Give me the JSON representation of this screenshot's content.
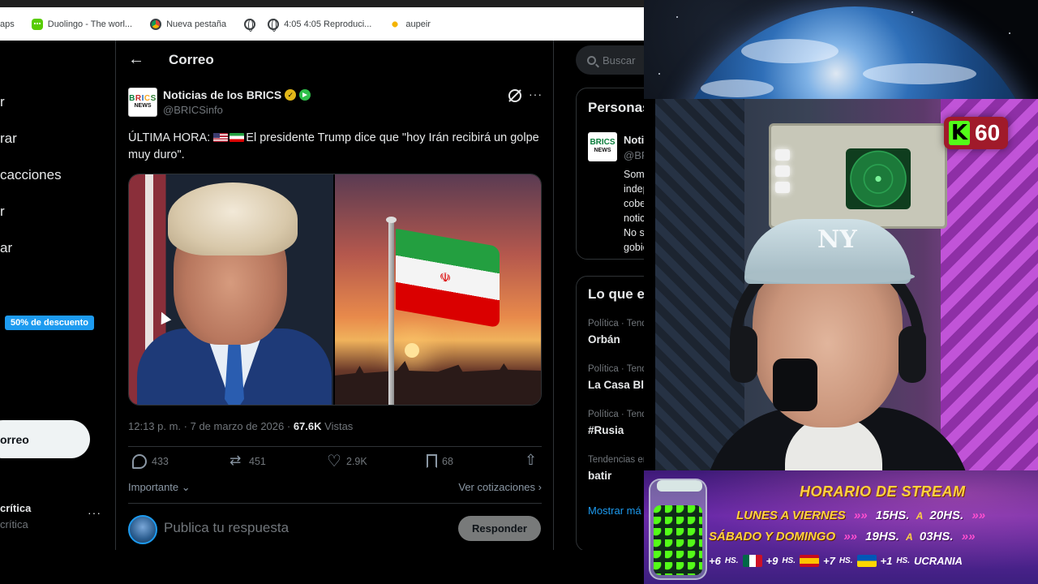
{
  "bookmarks": [
    {
      "label": "aps",
      "icon": "none"
    },
    {
      "label": "Duolingo - The worl...",
      "icon": "duolingo-icon"
    },
    {
      "label": "Nueva pestaña",
      "icon": "chrome-icon"
    },
    {
      "label": "",
      "icon": "globe-icon"
    },
    {
      "label": "4:05 4:05 Reproduci...",
      "icon": "globe-icon"
    },
    {
      "label": "aupeir",
      "icon": "aupeir-icon"
    }
  ],
  "leftnav": {
    "items": [
      "r",
      "rar",
      "cacciones",
      "r",
      "ar"
    ],
    "discount": "50% de descuento",
    "post_button": "orreo",
    "account_name": "crítica",
    "account_handle": "crítica",
    "more": "···"
  },
  "header": {
    "back_icon": "←",
    "title": "Correo"
  },
  "tweet": {
    "author_name": "Noticias de los BRICS",
    "author_handle": "@BRICSinfo",
    "avatar_top": "BRICS",
    "avatar_bottom": "NEWS",
    "more": "···",
    "text_prefix": "ÚLTIMA HORA: ",
    "text_body": "El presidente Trump dice que \"hoy Irán recibirá un golpe muy duro\".",
    "time": "12:13 p. m.",
    "date": "7 de marzo de 2026",
    "views_count": "67.6K",
    "views_label": "Vistas",
    "replies": "433",
    "reposts": "451",
    "likes": "2.9K",
    "bookmarks": "68",
    "importante": "Importante",
    "cotizaciones": "Ver cotizaciones",
    "reply_placeholder": "Publica tu respuesta",
    "reply_button": "Responder"
  },
  "sidebar": {
    "search_placeholder": "Buscar",
    "people_title": "Personas",
    "person_name": "Notici",
    "person_handle": "@BRIC",
    "person_bio": [
      "Somos",
      "indepe",
      "cobert",
      "notici",
      "No sor",
      "gobier"
    ],
    "trends_title": "Lo que est",
    "trends": [
      {
        "category": "Política · Tender",
        "name": "Orbán"
      },
      {
        "category": "Política · Tender",
        "name": "La Casa Blanc"
      },
      {
        "category": "Política · Tender",
        "name": "#Rusia"
      },
      {
        "category": "Tendencias en U",
        "name": "batir"
      }
    ],
    "show_more": "Mostrar má"
  },
  "stream": {
    "kick_logo": "K",
    "viewer_count": "60",
    "cap_logo": "NY",
    "schedule_title": "HORARIO DE STREAM",
    "rows": [
      {
        "days": "LUNES A VIERNES",
        "from": "15HS.",
        "sep": "A",
        "to": "20HS."
      },
      {
        "days": "SÁBADO Y DOMINGO",
        "from": "19HS.",
        "sep": "A",
        "to": "03HS."
      }
    ],
    "tz": [
      {
        "offset": "+6",
        "unit": "HS."
      },
      {
        "offset": "+9",
        "unit": "HS."
      },
      {
        "offset": "+7",
        "unit": "HS."
      },
      {
        "offset": "+1",
        "unit": "HS.",
        "label": "UCRANIA"
      }
    ],
    "arrows": "»»",
    "colors": {
      "kick_green": "#53fc18",
      "schedule_yellow": "#ffd23f",
      "accent_pink": "#ff4fd0"
    }
  }
}
